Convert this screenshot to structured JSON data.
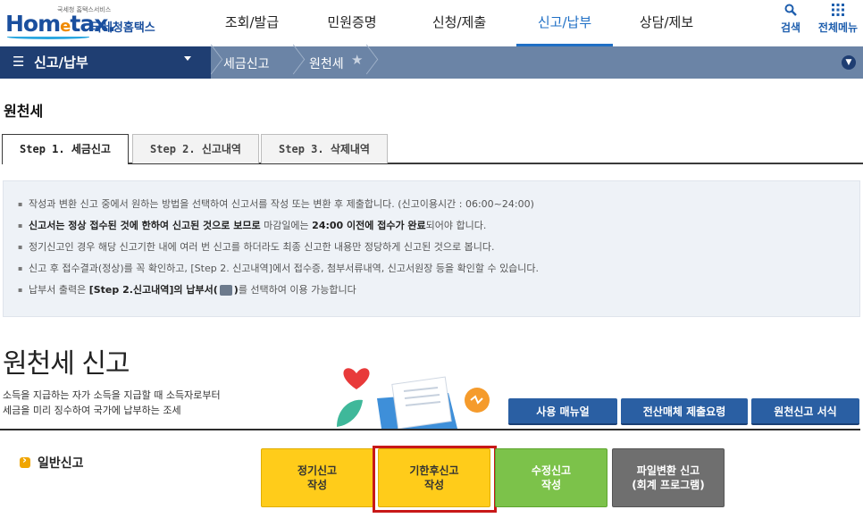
{
  "header": {
    "logo_small": "국세청 홈택스서비스",
    "logo_home": "Hom",
    "logo_e": "e",
    "logo_tax": "tax.",
    "logo_kr": "국세청홈택스",
    "nav": [
      {
        "label": "조회/발급",
        "active": false
      },
      {
        "label": "민원증명",
        "active": false
      },
      {
        "label": "신청/제출",
        "active": false
      },
      {
        "label": "신고/납부",
        "active": true
      },
      {
        "label": "상담/제보",
        "active": false
      }
    ],
    "search_label": "검색",
    "allmenu_label": "전체메뉴",
    "accent_color": "#1f6fc5"
  },
  "locbar": {
    "main_menu": "신고/납부",
    "crumbs": [
      "세금신고",
      "원천세"
    ]
  },
  "page_title": "원천세",
  "tabs": [
    {
      "label": "Step 1. 세금신고",
      "active": true
    },
    {
      "label": "Step 2. 신고내역",
      "active": false
    },
    {
      "label": "Step 3. 삭제내역",
      "active": false
    }
  ],
  "notice": {
    "line1": "작성과 변환 신고 중에서 원하는 방법을 선택하여 신고서를 작성 또는 변환 후 제출합니다. (신고이용시간 : 06:00~24:00)",
    "line2_b1": "신고서는 정상 접수된 것에 한하여 신고된 것으로 보므로",
    "line2_t1": " 마감일에는 ",
    "line2_b2": "24:00 이전에 접수가 완료",
    "line2_t2": "되어야 합니다.",
    "line3": "정기신고인 경우 해당 신고기한 내에 여러 번 신고를 하더라도 최종 신고한 내용만 정당하게 신고된 것으로 봅니다.",
    "line4": "신고 후 접수결과(정상)를 꼭 확인하고, [Step 2. 신고내역]에서 접수증, 첨부서류내역, 신고서원장 등을 확인할 수 있습니다.",
    "line5_t1": "납부서 출력은 ",
    "line5_b1": "[Step 2.신고내역]의 납부서(",
    "line5_b2": ")",
    "line5_t2": "를 선택하여 이용 가능합니다"
  },
  "section": {
    "title": "원천세 신고",
    "desc1": "소득을 지급하는 자가 소득을 지급할 때 소득자로부터",
    "desc2": "세금을 미리 징수하여 국가에 납부하는 조세",
    "buttons": [
      "사용 매뉴얼",
      "전산매체 제출요령",
      "원천신고 서식"
    ]
  },
  "general": {
    "label": "일반신고",
    "actions": [
      {
        "line1": "정기신고",
        "line2": "작성",
        "color": "yellow",
        "highlighted": false
      },
      {
        "line1": "기한후신고",
        "line2": "작성",
        "color": "yellow",
        "highlighted": true
      },
      {
        "line1": "수정신고",
        "line2": "작성",
        "color": "green",
        "highlighted": false
      },
      {
        "line1": "파일변환 신고",
        "line2": "(회계 프로그램)",
        "color": "gray",
        "highlighted": false
      }
    ]
  }
}
